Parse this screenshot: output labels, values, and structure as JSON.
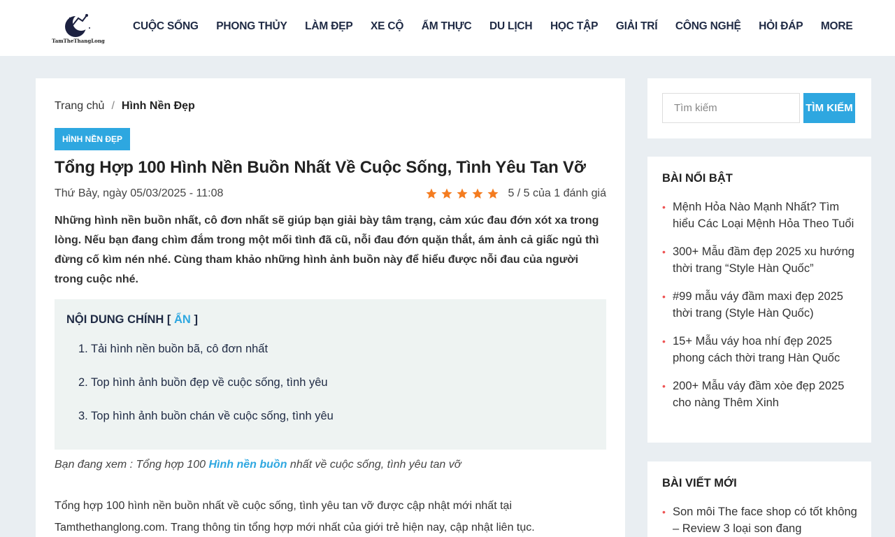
{
  "header": {
    "logo_text": "TamTheThangLong",
    "nav": [
      "CUỘC SỐNG",
      "PHONG THỦY",
      "LÀM ĐẸP",
      "XE CỘ",
      "ẨM THỰC",
      "DU LỊCH",
      "HỌC TẬP",
      "GIẢI TRÍ",
      "CÔNG NGHỆ",
      "HỎI ĐÁP",
      "MORE"
    ]
  },
  "breadcrumb": {
    "home": "Trang chủ",
    "separator": "/",
    "current": "Hình Nền Đẹp"
  },
  "article": {
    "category": "HÌNH NỀN ĐẸP",
    "title": "Tổng Hợp 100 Hình Nền Buồn Nhất Về Cuộc Sống, Tình Yêu Tan Vỡ",
    "date": "Thứ Bảy, ngày 05/03/2025 - 11:08",
    "rating_stars": 5,
    "rating_text": "5 / 5 của 1 đánh giá",
    "intro": "Những hình nền buồn nhất, cô đơn nhất sẽ giúp bạn giải bày tâm trạng, cảm xúc đau đớn xót xa trong lòng. Nếu bạn đang chìm đắm trong một mối tình đã cũ, nỗi đau đớn quặn thắt, ám ảnh cả giấc ngủ thì đừng cố kìm nén nhé. Cùng tham khảo những hình ảnh buồn này để hiểu được nỗi đau của người trong cuộc nhé.",
    "toc": {
      "title": "NỘI DUNG CHÍNH",
      "toggle": "ẨN",
      "items": [
        "1. Tải hình nền buồn bã, cô đơn nhất",
        "2. Top hình ảnh buồn đẹp về cuộc sống, tình yêu",
        "3. Top hình ảnh buồn chán về cuộc sống, tình yêu"
      ]
    },
    "viewing_prefix": "Bạn đang xem : Tổng hợp 100 ",
    "viewing_link": "Hình nền buồn",
    "viewing_suffix": " nhất về cuộc sống, tình yêu tan vỡ",
    "body": "Tổng hợp 100 hình nền buồn nhất về cuộc sống, tình yêu tan vỡ được cập nhật mới nhất tại Tamthethanglong.com. Trang thông tin tổng hợp mới nhất của giới trẻ hiện nay, cập nhật liên tục."
  },
  "sidebar": {
    "search_placeholder": "Tìm kiếm",
    "search_button": "TÌM KIẾM",
    "featured": {
      "title": "BÀI NỔI BẬT",
      "items": [
        "Mệnh Hỏa Nào Mạnh Nhất? Tìm hiểu Các Loại Mệnh Hỏa Theo Tuổi",
        "300+ Mẫu đầm đẹp 2025 xu hướng thời trang “Style Hàn Quốc”",
        "#99 mẫu váy đầm maxi đẹp 2025 thời trang (Style Hàn Quốc)",
        "15+ Mẫu váy hoa nhí đẹp 2025 phong cách thời trang Hàn Quốc",
        "200+ Mẫu váy đầm xòe đẹp 2025 cho nàng Thêm Xinh"
      ]
    },
    "latest": {
      "title": "BÀI VIẾT MỚI",
      "items": [
        "Son môi The face shop có tốt không – Review 3 loại son đang"
      ]
    }
  },
  "colors": {
    "accent": "#2ea7e0",
    "star": "#f47c20",
    "bullet": "#ee5555",
    "background": "#e9eef2"
  }
}
